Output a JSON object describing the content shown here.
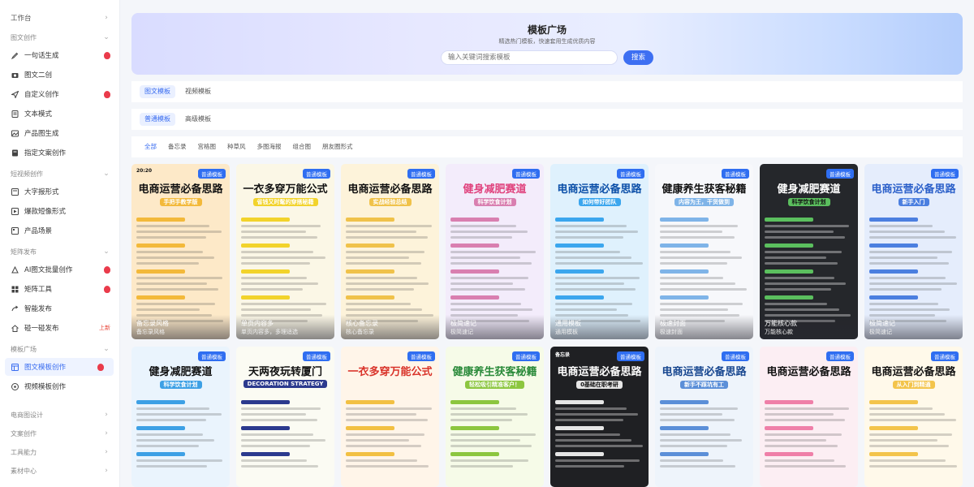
{
  "sidebar": {
    "top_item": "工作台",
    "groups": [
      {
        "label": "图文创作",
        "items": [
          {
            "label": "一句话生成",
            "icon": "edit-icon",
            "hot": true
          },
          {
            "label": "图文二创",
            "icon": "camera-icon",
            "hot": false
          },
          {
            "label": "自定义创作",
            "icon": "send-icon",
            "hot": true
          },
          {
            "label": "文本模式",
            "icon": "doc-icon",
            "hot": false
          },
          {
            "label": "产品图生成",
            "icon": "image-icon",
            "hot": false
          },
          {
            "label": "指定文案创作",
            "icon": "file-icon",
            "hot": false
          }
        ]
      },
      {
        "label": "短视频创作",
        "items": [
          {
            "label": "大字报形式",
            "icon": "poster-icon",
            "hot": false
          },
          {
            "label": "爆款短像形式",
            "icon": "video-icon",
            "hot": false
          },
          {
            "label": "产品场景",
            "icon": "scene-icon",
            "hot": false
          }
        ]
      },
      {
        "label": "矩阵发布",
        "items": [
          {
            "label": "AI图文批量创作",
            "icon": "ai-icon",
            "hot": true
          },
          {
            "label": "矩阵工具",
            "icon": "grid-icon",
            "hot": true
          },
          {
            "label": "智能发布",
            "icon": "share-icon",
            "hot": false
          },
          {
            "label": "碰一碰发布",
            "icon": "home-icon",
            "hot": false,
            "badge": "上新"
          }
        ]
      },
      {
        "label": "模板广场",
        "items": [
          {
            "label": "图文模板创作",
            "icon": "template-icon",
            "hot": true,
            "active": true
          },
          {
            "label": "视频模板创作",
            "icon": "film-icon",
            "hot": false
          }
        ]
      }
    ],
    "bottom_groups": [
      "电商图设计",
      "文案创作",
      "工具能力",
      "素材中心"
    ]
  },
  "hero": {
    "title": "模板广场",
    "subtitle": "精选热门模板，快速套用生成优质内容",
    "search_placeholder": "输入关键词搜索模板",
    "search_button": "搜索"
  },
  "tabs_type": [
    {
      "label": "图文模板",
      "active": true
    },
    {
      "label": "视频模板",
      "active": false
    }
  ],
  "tabs_level": [
    {
      "label": "普通模板",
      "active": true
    },
    {
      "label": "高级模板",
      "active": false
    }
  ],
  "tabs_style": [
    {
      "label": "全部",
      "active": true
    },
    {
      "label": "备忘录",
      "active": false
    },
    {
      "label": "宫格图",
      "active": false
    },
    {
      "label": "种草风",
      "active": false
    },
    {
      "label": "多图海报",
      "active": false
    },
    {
      "label": "组合图",
      "active": false
    },
    {
      "label": "朋友圈形式",
      "active": false
    }
  ],
  "card_tag": "普通模板",
  "cards_row1": [
    {
      "title": "电商运营必备思路",
      "sub": "手把手教学版",
      "corner": "20:20",
      "name": "备忘录风格",
      "desc": "备忘录风格",
      "bg": "#fde9c8",
      "fg": "#111111",
      "accent": "#f3b93a"
    },
    {
      "title": "一衣多穿万能公式",
      "sub": "省钱又时髦的穿搭秘籍",
      "corner": "",
      "name": "单页内容多",
      "desc": "单页内容多，多理适选",
      "bg": "#fbf7e6",
      "fg": "#111111",
      "accent": "#f2d32b"
    },
    {
      "title": "电商运营必备思路",
      "sub": "实战经验总结",
      "corner": "",
      "name": "核心备忘录",
      "desc": "核心备忘录",
      "bg": "#fdf3da",
      "fg": "#111111",
      "accent": "#f0c24a"
    },
    {
      "title": "健身减肥赛道",
      "sub": "科学饮食计划",
      "corner": "",
      "name": "极简速记",
      "desc": "极简速记",
      "bg": "#f3ecfb",
      "fg": "#e0427d",
      "accent": "#d97fb0"
    },
    {
      "title": "电商运营必备思路",
      "sub": "如何带好团队",
      "corner": "",
      "name": "通用模板",
      "desc": "通用模板",
      "bg": "#dff1fd",
      "fg": "#0b4fa8",
      "accent": "#3ba6ee"
    },
    {
      "title": "健康养生获客秘籍",
      "sub": "内容为王，干货做到",
      "corner": "",
      "name": "极速封面",
      "desc": "极速封面",
      "bg": "#f7f8fb",
      "fg": "#111111",
      "accent": "#7fb4e8"
    },
    {
      "title": "健身减肥赛道",
      "sub": "科学饮食计划",
      "corner": "",
      "name": "万能核心款",
      "desc": "万能核心款",
      "bg": "#25272b",
      "fg": "#ffffff",
      "accent": "#5bbf5e"
    },
    {
      "title": "电商运营必备思路",
      "sub": "新手入门",
      "corner": "",
      "name": "极简速记",
      "desc": "极简速记",
      "bg": "#e5edfc",
      "fg": "#2a5fc9",
      "accent": "#4b7fe0"
    }
  ],
  "cards_row2": [
    {
      "title": "健身减肥赛道",
      "sub": "科学饮食计划",
      "corner": "",
      "bg": "#eaf4fd",
      "fg": "#111111",
      "accent": "#3da0e5"
    },
    {
      "title": "天两夜玩转厦门",
      "sub": "DECORATION STRATEGY",
      "corner": "",
      "bg": "#fbfbf3",
      "fg": "#111111",
      "accent": "#2c3a8e"
    },
    {
      "title": "一衣多穿万能公式",
      "sub": "",
      "corner": "",
      "bg": "#fff5e9",
      "fg": "#d9332a",
      "accent": "#f2c043"
    },
    {
      "title": "健康养生获客秘籍",
      "sub": "轻松吸引精准客户！",
      "corner": "",
      "bg": "#f6fbe8",
      "fg": "#2a8a3a",
      "accent": "#8cc63f"
    },
    {
      "title": "电商运营必备思路",
      "sub": "0基础在职考研",
      "corner": "备忘录",
      "bg": "#1f2023",
      "fg": "#ffffff",
      "accent": "#e6e6e6"
    },
    {
      "title": "电商运营必备思路",
      "sub": "新手不踩坑有工",
      "corner": "",
      "bg": "#eef4fb",
      "fg": "#17468f",
      "accent": "#5b8fd8"
    },
    {
      "title": "电商运营必备思路",
      "sub": "",
      "corner": "",
      "bg": "#fceef3",
      "fg": "#111111",
      "accent": "#ef7fa8"
    },
    {
      "title": "电商运营必备思路",
      "sub": "从入门到精通",
      "corner": "",
      "bg": "#fff9ea",
      "fg": "#111111",
      "accent": "#f3c44b"
    }
  ]
}
